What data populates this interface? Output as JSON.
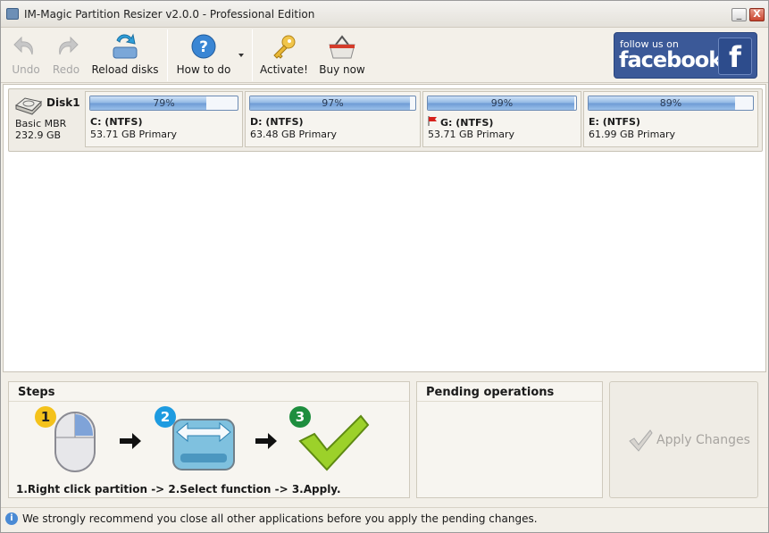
{
  "window": {
    "title": "IM-Magic Partition Resizer v2.0.0 - Professional Edition",
    "minimize": "_",
    "close": "X"
  },
  "toolbar": {
    "undo": "Undo",
    "redo": "Redo",
    "reload": "Reload disks",
    "howto": "How to do",
    "activate": "Activate!",
    "buynow": "Buy now",
    "facebook_line1": "follow us on",
    "facebook_line2": "facebook",
    "facebook_f": "f"
  },
  "disk": {
    "name": "Disk1",
    "type": "Basic MBR",
    "size": "232.9 GB",
    "partitions": [
      {
        "used_pct": 79,
        "pct_label": "79%",
        "name": "C: (NTFS)",
        "detail": "53.71 GB Primary",
        "flag": false
      },
      {
        "used_pct": 97,
        "pct_label": "97%",
        "name": "D: (NTFS)",
        "detail": "63.48 GB Primary",
        "flag": false
      },
      {
        "used_pct": 99,
        "pct_label": "99%",
        "name": "G: (NTFS)",
        "detail": "53.71 GB Primary",
        "flag": true
      },
      {
        "used_pct": 89,
        "pct_label": "89%",
        "name": "E: (NTFS)",
        "detail": "61.99 GB Primary",
        "flag": false
      }
    ]
  },
  "steps": {
    "title": "Steps",
    "numbers": [
      "1",
      "2",
      "3"
    ],
    "text": "1.Right click partition -> 2.Select function -> 3.Apply."
  },
  "pending": {
    "title": "Pending operations"
  },
  "apply": {
    "label": "Apply Changes"
  },
  "status": {
    "icon": "i",
    "text": "We strongly recommend you close all other applications before you apply the pending changes."
  },
  "colors": {
    "accent": "#3b5998",
    "bar_fill": "#8fb6e3",
    "step1": "#f4c21b",
    "step2": "#1e9be0",
    "step3": "#1e8e3e"
  }
}
